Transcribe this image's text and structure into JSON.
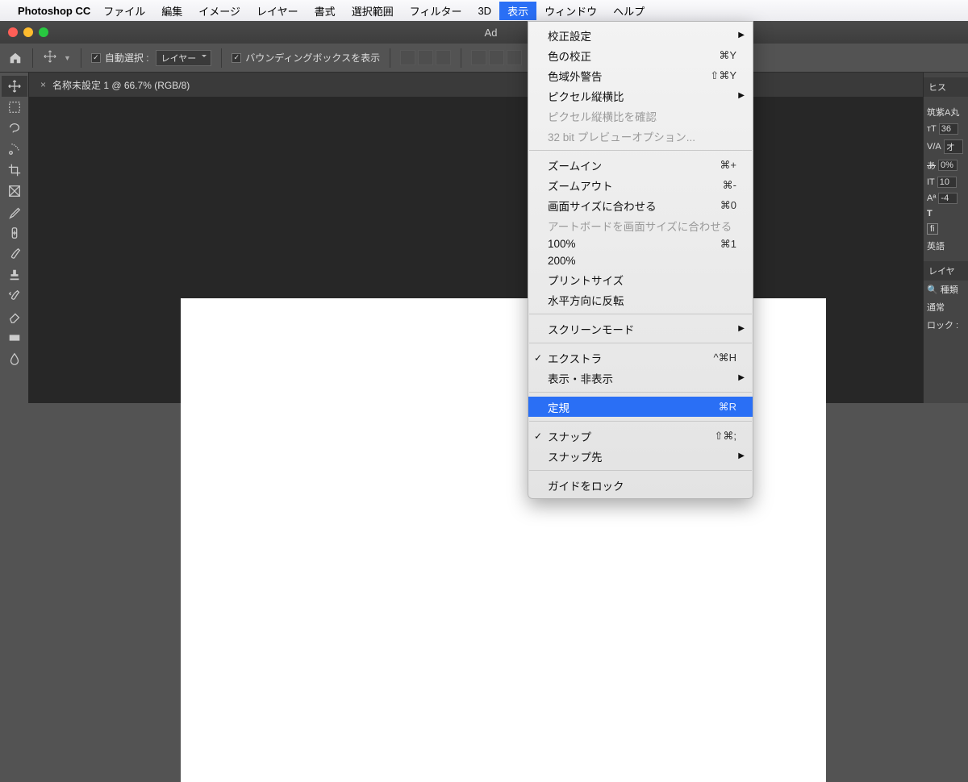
{
  "macbar": {
    "appname": "Photoshop CC",
    "items": [
      "ファイル",
      "編集",
      "イメージ",
      "レイヤー",
      "書式",
      "選択範囲",
      "フィルター",
      "3D",
      "表示",
      "ウィンドウ",
      "ヘルプ"
    ],
    "active_index": 8
  },
  "window": {
    "title": "Ad"
  },
  "optionbar": {
    "auto_select": "自動選択 :",
    "layer_dropdown": "レイヤー",
    "show_bounding": "バウンディングボックスを表示"
  },
  "document": {
    "tab": "名称未設定 1 @ 66.7% (RGB/8)"
  },
  "rpanel": {
    "tab1": "ヒス",
    "font": "筑紫A丸",
    "size": "36",
    "sizeUnit": "オ",
    "va": "オ",
    "aw": "0%",
    "it": "10",
    "at": "-4",
    "t_label": "T",
    "fi_label": "fi",
    "lang": "英語",
    "tab2": "レイヤ",
    "search": "種類",
    "blend": "通常",
    "lock": "ロック :"
  },
  "view_menu": {
    "groups": [
      [
        {
          "label": "校正設定",
          "sub": true
        },
        {
          "label": "色の校正",
          "shortcut": "⌘Y"
        },
        {
          "label": "色域外警告",
          "shortcut": "⇧⌘Y"
        },
        {
          "label": "ピクセル縦横比",
          "sub": true
        },
        {
          "label": "ピクセル縦横比を確認",
          "disabled": true
        },
        {
          "label": "32 bit プレビューオプション...",
          "disabled": true
        }
      ],
      [
        {
          "label": "ズームイン",
          "shortcut": "⌘+"
        },
        {
          "label": "ズームアウト",
          "shortcut": "⌘-"
        },
        {
          "label": "画面サイズに合わせる",
          "shortcut": "⌘0"
        },
        {
          "label": "アートボードを画面サイズに合わせる",
          "disabled": true
        },
        {
          "label": "100%",
          "shortcut": "⌘1"
        },
        {
          "label": "200%"
        },
        {
          "label": "プリントサイズ"
        },
        {
          "label": "水平方向に反転"
        }
      ],
      [
        {
          "label": "スクリーンモード",
          "sub": true
        }
      ],
      [
        {
          "label": "エクストラ",
          "shortcut": "^⌘H",
          "check": true
        },
        {
          "label": "表示・非表示",
          "sub": true
        }
      ],
      [
        {
          "label": "定規",
          "shortcut": "⌘R",
          "highlight": true
        }
      ],
      [
        {
          "label": "スナップ",
          "shortcut": "⇧⌘;",
          "check": true
        },
        {
          "label": "スナップ先",
          "sub": true
        }
      ],
      [
        {
          "label": "ガイドをロック"
        }
      ]
    ]
  }
}
